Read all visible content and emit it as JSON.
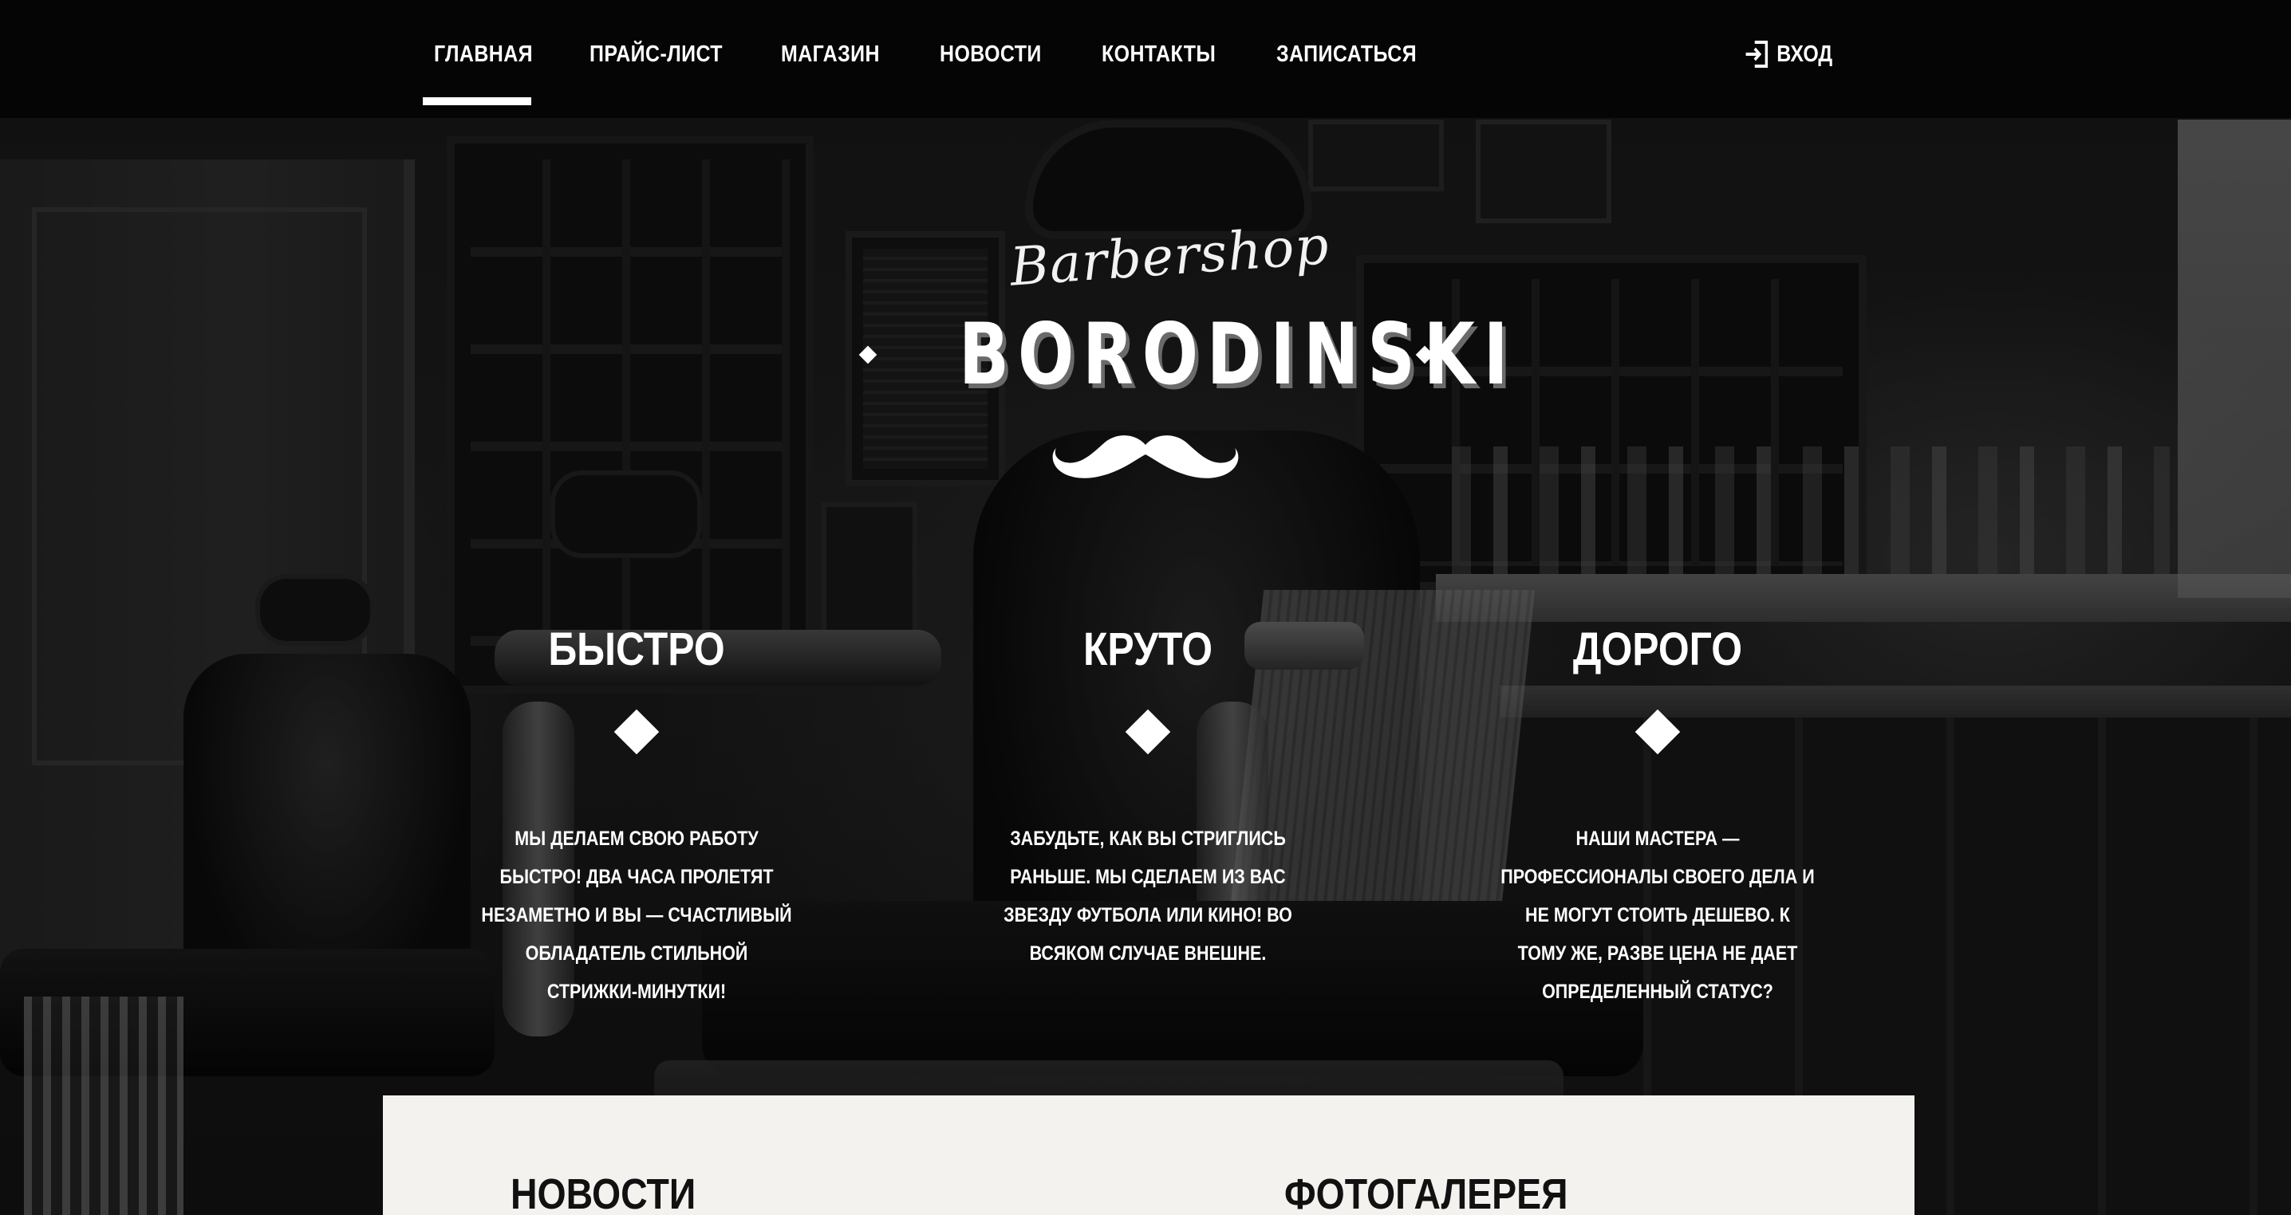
{
  "nav": {
    "items": [
      {
        "label": "ГЛАВНАЯ",
        "active": true
      },
      {
        "label": "ПРАЙС-ЛИСТ",
        "active": false
      },
      {
        "label": "МАГАЗИН",
        "active": false
      },
      {
        "label": "НОВОСТИ",
        "active": false
      },
      {
        "label": "КОНТАКТЫ",
        "active": false
      },
      {
        "label": "ЗАПИСАТЬСЯ",
        "active": false
      }
    ],
    "login_label": "ВХОД",
    "login_icon": "login-icon"
  },
  "logo": {
    "script": "Barbershop",
    "name": "BORODINSKI",
    "icon": "mustache-icon"
  },
  "features": [
    {
      "title": "БЫСТРО",
      "text": "Мы делаем свою работу быстро! Два часа пролетят незаметно и вы — счастливый обладатель стильной стрижки-минутки!"
    },
    {
      "title": "КРУТО",
      "text": "Забудьте, как вы стриглись раньше. Мы сделаем из вас звезду футбола или кино! Во всяком случае внешне."
    },
    {
      "title": "ДОРОГО",
      "text": "Наши мастера — профессионалы своего дела и не могут стоить дешево. К тому же, разве цена не дает определенный статус?"
    }
  ],
  "panel": {
    "news_heading": "НОВОСТИ",
    "gallery_heading": "ФОТОГАЛЕРЕЯ"
  },
  "colors": {
    "nav_bg": "#050505",
    "accent": "#ffffff",
    "panel_bg": "#f4f2ee"
  }
}
